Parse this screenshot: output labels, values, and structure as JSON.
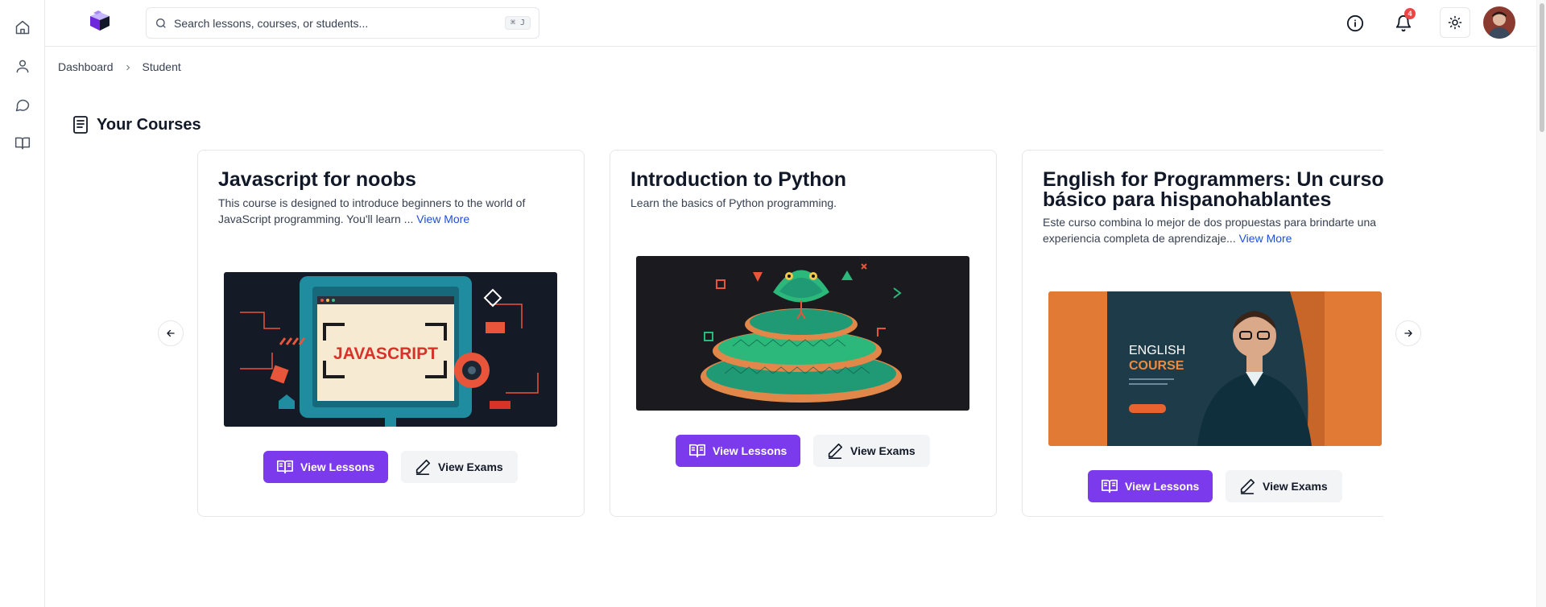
{
  "search": {
    "placeholder": "Search lessons, courses, or students...",
    "shortcut": "⌘ J"
  },
  "notifications": {
    "count": "4"
  },
  "breadcrumb": [
    "Dashboard",
    "Student"
  ],
  "section": {
    "title": "Your Courses"
  },
  "courses": [
    {
      "title": "Javascript for noobs",
      "description": "This course is designed to introduce beginners to the world of JavaScript programming. You'll learn ...",
      "view_more": "View More",
      "image_text": "JAVASCRIPT"
    },
    {
      "title": "Introduction to Python",
      "description": "Learn the basics of Python programming.",
      "view_more": ""
    },
    {
      "title": "English for Programmers: Un curso básico para hispanohablantes",
      "description": "Este curso combina lo mejor de dos propuestas para brindarte una experiencia completa de aprendizaje...",
      "view_more": "View More",
      "image_text_1": "ENGLISH",
      "image_text_2": "COURSE"
    }
  ],
  "buttons": {
    "lessons": "View Lessons",
    "exams": "View Exams"
  },
  "colors": {
    "primary": "#7c3aed",
    "link": "#1d4ed8",
    "badge": "#ef4444"
  }
}
